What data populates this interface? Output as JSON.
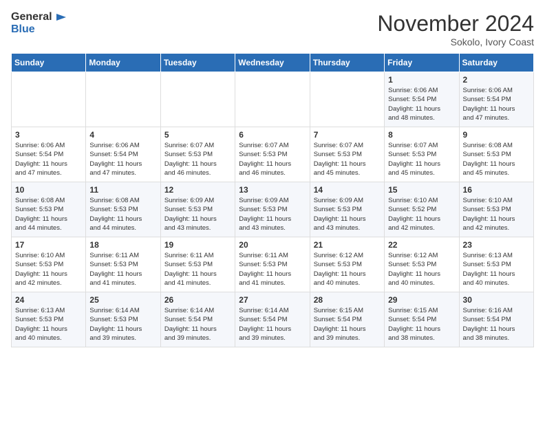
{
  "logo": {
    "general": "General",
    "blue": "Blue"
  },
  "header": {
    "month": "November 2024",
    "location": "Sokolo, Ivory Coast"
  },
  "weekdays": [
    "Sunday",
    "Monday",
    "Tuesday",
    "Wednesday",
    "Thursday",
    "Friday",
    "Saturday"
  ],
  "weeks": [
    [
      {
        "day": "",
        "info": ""
      },
      {
        "day": "",
        "info": ""
      },
      {
        "day": "",
        "info": ""
      },
      {
        "day": "",
        "info": ""
      },
      {
        "day": "",
        "info": ""
      },
      {
        "day": "1",
        "info": "Sunrise: 6:06 AM\nSunset: 5:54 PM\nDaylight: 11 hours\nand 48 minutes."
      },
      {
        "day": "2",
        "info": "Sunrise: 6:06 AM\nSunset: 5:54 PM\nDaylight: 11 hours\nand 47 minutes."
      }
    ],
    [
      {
        "day": "3",
        "info": "Sunrise: 6:06 AM\nSunset: 5:54 PM\nDaylight: 11 hours\nand 47 minutes."
      },
      {
        "day": "4",
        "info": "Sunrise: 6:06 AM\nSunset: 5:54 PM\nDaylight: 11 hours\nand 47 minutes."
      },
      {
        "day": "5",
        "info": "Sunrise: 6:07 AM\nSunset: 5:53 PM\nDaylight: 11 hours\nand 46 minutes."
      },
      {
        "day": "6",
        "info": "Sunrise: 6:07 AM\nSunset: 5:53 PM\nDaylight: 11 hours\nand 46 minutes."
      },
      {
        "day": "7",
        "info": "Sunrise: 6:07 AM\nSunset: 5:53 PM\nDaylight: 11 hours\nand 45 minutes."
      },
      {
        "day": "8",
        "info": "Sunrise: 6:07 AM\nSunset: 5:53 PM\nDaylight: 11 hours\nand 45 minutes."
      },
      {
        "day": "9",
        "info": "Sunrise: 6:08 AM\nSunset: 5:53 PM\nDaylight: 11 hours\nand 45 minutes."
      }
    ],
    [
      {
        "day": "10",
        "info": "Sunrise: 6:08 AM\nSunset: 5:53 PM\nDaylight: 11 hours\nand 44 minutes."
      },
      {
        "day": "11",
        "info": "Sunrise: 6:08 AM\nSunset: 5:53 PM\nDaylight: 11 hours\nand 44 minutes."
      },
      {
        "day": "12",
        "info": "Sunrise: 6:09 AM\nSunset: 5:53 PM\nDaylight: 11 hours\nand 43 minutes."
      },
      {
        "day": "13",
        "info": "Sunrise: 6:09 AM\nSunset: 5:53 PM\nDaylight: 11 hours\nand 43 minutes."
      },
      {
        "day": "14",
        "info": "Sunrise: 6:09 AM\nSunset: 5:53 PM\nDaylight: 11 hours\nand 43 minutes."
      },
      {
        "day": "15",
        "info": "Sunrise: 6:10 AM\nSunset: 5:52 PM\nDaylight: 11 hours\nand 42 minutes."
      },
      {
        "day": "16",
        "info": "Sunrise: 6:10 AM\nSunset: 5:53 PM\nDaylight: 11 hours\nand 42 minutes."
      }
    ],
    [
      {
        "day": "17",
        "info": "Sunrise: 6:10 AM\nSunset: 5:53 PM\nDaylight: 11 hours\nand 42 minutes."
      },
      {
        "day": "18",
        "info": "Sunrise: 6:11 AM\nSunset: 5:53 PM\nDaylight: 11 hours\nand 41 minutes."
      },
      {
        "day": "19",
        "info": "Sunrise: 6:11 AM\nSunset: 5:53 PM\nDaylight: 11 hours\nand 41 minutes."
      },
      {
        "day": "20",
        "info": "Sunrise: 6:11 AM\nSunset: 5:53 PM\nDaylight: 11 hours\nand 41 minutes."
      },
      {
        "day": "21",
        "info": "Sunrise: 6:12 AM\nSunset: 5:53 PM\nDaylight: 11 hours\nand 40 minutes."
      },
      {
        "day": "22",
        "info": "Sunrise: 6:12 AM\nSunset: 5:53 PM\nDaylight: 11 hours\nand 40 minutes."
      },
      {
        "day": "23",
        "info": "Sunrise: 6:13 AM\nSunset: 5:53 PM\nDaylight: 11 hours\nand 40 minutes."
      }
    ],
    [
      {
        "day": "24",
        "info": "Sunrise: 6:13 AM\nSunset: 5:53 PM\nDaylight: 11 hours\nand 40 minutes."
      },
      {
        "day": "25",
        "info": "Sunrise: 6:14 AM\nSunset: 5:53 PM\nDaylight: 11 hours\nand 39 minutes."
      },
      {
        "day": "26",
        "info": "Sunrise: 6:14 AM\nSunset: 5:54 PM\nDaylight: 11 hours\nand 39 minutes."
      },
      {
        "day": "27",
        "info": "Sunrise: 6:14 AM\nSunset: 5:54 PM\nDaylight: 11 hours\nand 39 minutes."
      },
      {
        "day": "28",
        "info": "Sunrise: 6:15 AM\nSunset: 5:54 PM\nDaylight: 11 hours\nand 39 minutes."
      },
      {
        "day": "29",
        "info": "Sunrise: 6:15 AM\nSunset: 5:54 PM\nDaylight: 11 hours\nand 38 minutes."
      },
      {
        "day": "30",
        "info": "Sunrise: 6:16 AM\nSunset: 5:54 PM\nDaylight: 11 hours\nand 38 minutes."
      }
    ]
  ]
}
